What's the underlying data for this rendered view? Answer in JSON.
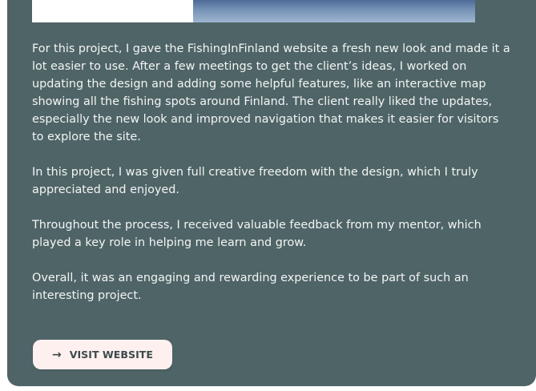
{
  "project": {
    "paragraphs": [
      "For this project, I gave the FishingInFinland website a fresh new look and made it a lot easier to use. After a few meetings to get the client’s ideas, I worked on updating the design and adding some helpful features, like an interactive map showing all the fishing spots around Finland. The client really liked the updates, especially the new look and improved navigation that makes it easier for visitors to explore the site.",
      "In this project, I was given full creative freedom with the design, which I truly appreciated and enjoyed.",
      "Throughout the process, I received valuable feedback from my mentor, which played a key role in helping me learn and grow.",
      "Overall, it was an engaging and rewarding experience to be part of such an interesting project."
    ],
    "cta": {
      "icon": "arrow-right-icon",
      "label": "VISIT WEBSITE"
    }
  },
  "colors": {
    "card_background": "#4f6467",
    "text": "#f3f5f4",
    "button_background": "#fdf0ef",
    "button_text": "#3e4a4c"
  }
}
